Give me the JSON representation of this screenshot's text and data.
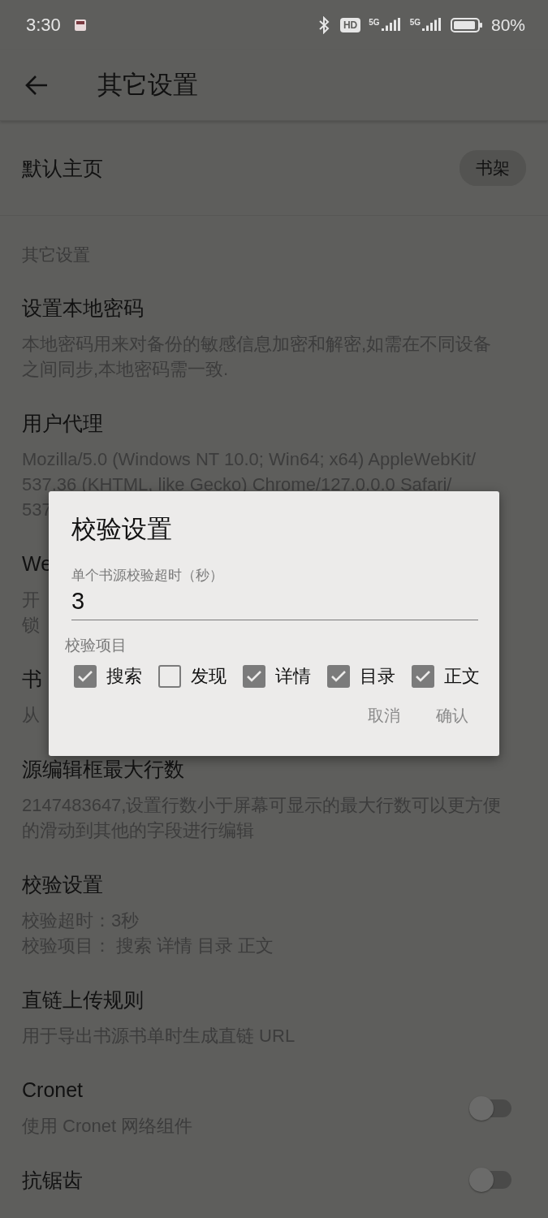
{
  "status_bar": {
    "time": "3:30",
    "network_labels": [
      "5G",
      "5G"
    ],
    "hd_badge": "HD",
    "battery": "80%"
  },
  "header": {
    "title": "其它设置"
  },
  "default_page": {
    "label": "默认主页",
    "value": "书架"
  },
  "section": {
    "title": "其它设置"
  },
  "settings": [
    {
      "kind": "text",
      "title": "设置本地密码",
      "description": [
        "本地密码用来对备份的敏感信息加密和解密,如需在不同设备",
        "之间同步,本地密码需一致."
      ]
    },
    {
      "kind": "text",
      "title": "用户代理",
      "description": [
        "Mozilla/5.0 (Windows NT 10.0; Win64; x64) AppleWebKit/",
        "537.36 (KHTML, like Gecko) Chrome/127.0.0.0 Safari/",
        "537"
      ]
    },
    {
      "kind": "text",
      "title": "We",
      "description": [
        "开",
        "锁"
      ]
    },
    {
      "kind": "text",
      "title": "书",
      "description": [
        "从"
      ]
    },
    {
      "kind": "text",
      "title": "源编辑框最大行数",
      "description": [
        "2147483647,设置行数小于屏幕可显示的最大行数可以更方便",
        "的滑动到其他的字段进行编辑"
      ]
    },
    {
      "kind": "text",
      "title": "校验设置",
      "description": [
        "校验超时：3秒",
        "校验项目： 搜索 详情 目录 正文"
      ]
    },
    {
      "kind": "text",
      "title": "直链上传规则",
      "description": [
        "用于导出书源书单时生成直链 URL"
      ]
    },
    {
      "kind": "switch",
      "title": "Cronet",
      "description": [
        "使用 Cronet 网络组件"
      ],
      "on": false
    },
    {
      "kind": "switch",
      "title": "抗锯齿",
      "on": false
    }
  ],
  "dialog": {
    "title": "校验设置",
    "field_label": "单个书源校验超时（秒）",
    "field_value": "3",
    "items_label": "校验项目",
    "items": [
      {
        "label": "搜索",
        "checked": true
      },
      {
        "label": "发现",
        "checked": false
      },
      {
        "label": "详情",
        "checked": true
      },
      {
        "label": "目录",
        "checked": true
      },
      {
        "label": "正文",
        "checked": true
      }
    ],
    "buttons": [
      "取消",
      "确认"
    ]
  }
}
